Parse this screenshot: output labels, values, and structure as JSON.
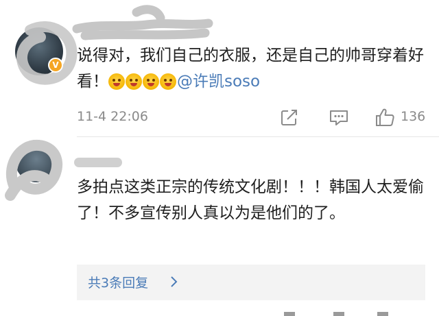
{
  "comments": [
    {
      "text_main": "说得对，我们自己的衣服，还是自己的帅哥穿着好看！",
      "mention": "@许凯soso",
      "timestamp": "11-4 22:06",
      "like_count": "136",
      "emoji_count": 4
    },
    {
      "text_main": "多拍点这类正宗的传统文化剧！！！韩国人太爱偷了！不多宣传别人真以为是他们的了。",
      "replies_label": "共3条回复"
    }
  ],
  "colors": {
    "link": "#4a7bb7",
    "meta": "#8a8a8a",
    "badge": "#f5a623"
  }
}
